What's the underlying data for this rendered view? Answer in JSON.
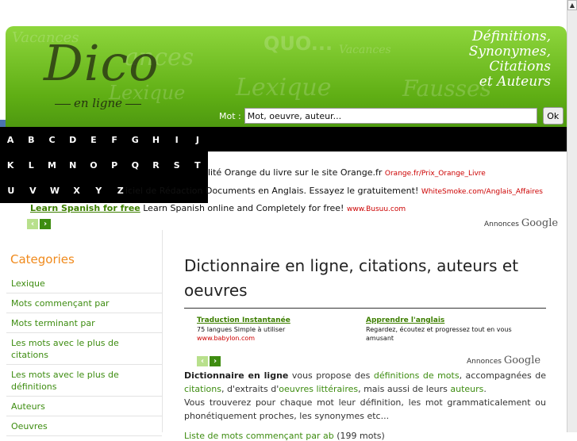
{
  "header": {
    "logo_main": "Dico",
    "logo_sub": "en ligne",
    "tagline": [
      "Définitions,",
      "Synonymes,",
      "Citations",
      "et Auteurs"
    ],
    "search_label": "Mot :",
    "search_value": "Mot, oeuvre, auteur...",
    "search_button": "Ok"
  },
  "alphabet": [
    [
      "A",
      "B",
      "C",
      "D",
      "E",
      "F",
      "G",
      "H",
      "I",
      "J"
    ],
    [
      "K",
      "L",
      "M",
      "N",
      "O",
      "P",
      "Q",
      "R",
      "S",
      "T"
    ],
    [
      "U",
      "V",
      "W",
      "X",
      "Y",
      "Z"
    ]
  ],
  "top_ads": [
    {
      "title": "",
      "text": "lité Orange du livre sur le site Orange.fr",
      "url": "Orange.fr/Prix_Orange_Livre"
    },
    {
      "title": "",
      "text": "iciel de Rédaction Documents en Anglais. Essayez le gratuitement!",
      "url": "WhiteSmoke.com/Anglais_Affaires"
    },
    {
      "title": "Learn Spanish for free",
      "text": "Learn Spanish online and Completely for free!",
      "url": "www.Busuu.com"
    }
  ],
  "ads_by": "Annonces",
  "google": "Google",
  "sidebar": {
    "title": "Categories",
    "items": [
      "Lexique",
      "Mots commençant par",
      "Mots terminant par",
      "Les mots avec le plus de citations",
      "Les mots avec le plus de définitions",
      "Auteurs",
      "Oeuvres"
    ]
  },
  "main": {
    "title": "Dictionnaire en ligne, citations, auteurs et oeuvres",
    "ads": [
      {
        "title": "Traduction Instantanée",
        "text": "75 langues Simple à utiliser",
        "url": "www.babylon.com"
      },
      {
        "title": "Apprendre l'anglais",
        "text": "Regardez, écoutez et progressez tout en vous amusant",
        "url": ""
      }
    ],
    "intro_bold": "Dictionnaire en ligne",
    "intro_1": " vous propose des ",
    "link_definitions": "définitions de mots",
    "intro_2": ",  accompagnées de ",
    "link_citations": "citations",
    "intro_3": ", d'extraits d'",
    "link_oeuvres": "oeuvres littéraires",
    "intro_4": ", mais aussi de leurs ",
    "link_auteurs": "auteurs",
    "intro_5": ".",
    "para2": "Vous trouverez pour chaque mot leur définition, les mot grammaticalement ou phonétiquement proches, les synonymes etc...",
    "list_link": "Liste de mots commençant par ab",
    "list_count": " (199 mots)"
  }
}
